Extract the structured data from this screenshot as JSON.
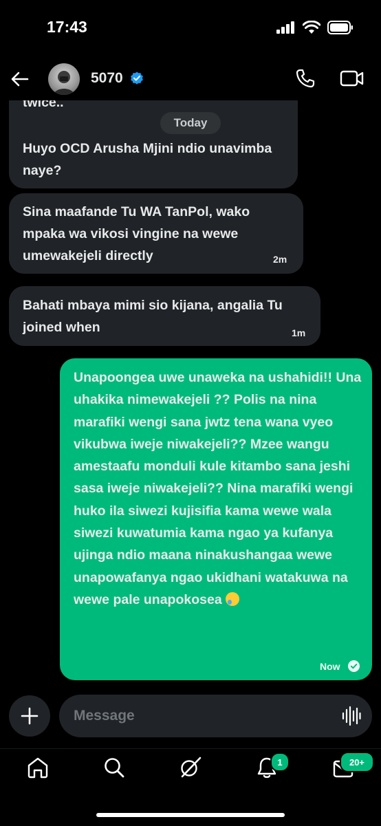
{
  "status_bar": {
    "time": "17:43"
  },
  "header": {
    "contact_name": "5070",
    "verified": true
  },
  "conversation": {
    "date_divider": "Today",
    "messages": [
      {
        "direction": "incoming",
        "text_top": "twice..",
        "text": "Huyo OCD Arusha Mjini ndio unavimba naye?",
        "time": ""
      },
      {
        "direction": "incoming",
        "text": "Sina maafande Tu WA TanPol, wako mpaka wa vikosi vingine na wewe umewakejeli directly",
        "time": "2m"
      },
      {
        "direction": "incoming",
        "text": "Bahati mbaya mimi sio kijana, angalia Tu joined when",
        "time": "1m"
      },
      {
        "direction": "outgoing",
        "text": "Unapoongea uwe unaweka na ushahidi!! Una uhakika nimewakejeli ?? Polis na nina marafiki wengi sana jwtz tena wana vyeo vikubwa iweje niwakejeli?? Mzee wangu amestaafu monduli kule kitambo sana jeshi sasa iweje niwakejeli?? Nina marafiki wengi huko ila siwezi kujisifia kama wewe wala siwezi kuwatumia kama ngao ya kufanya ujinga ndio maana ninakushangaa wewe unapowafanya ngao ukidhani watakuwa na wewe pale unapokosea",
        "emoji": "face-holding-back-tears",
        "time": "Now",
        "status": "read"
      }
    ]
  },
  "composer": {
    "placeholder": "Message"
  },
  "tab_bar": {
    "items": [
      "home",
      "search",
      "grok",
      "notifications",
      "messages"
    ],
    "notifications_badge": "1",
    "messages_badge": "20+"
  },
  "colors": {
    "accent": "#00ba7c",
    "bubble_incoming": "#202327",
    "verified": "#1d9bf0",
    "background": "#000000"
  }
}
